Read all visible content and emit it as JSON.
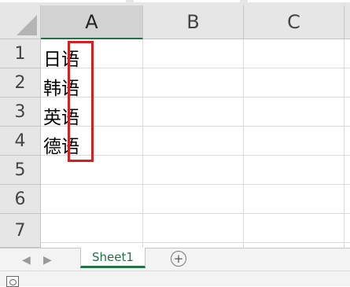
{
  "columns": [
    {
      "label": "A",
      "selected": true
    },
    {
      "label": "B",
      "selected": false
    },
    {
      "label": "C",
      "selected": false
    }
  ],
  "rows": [
    "1",
    "2",
    "3",
    "4",
    "5",
    "6",
    "7"
  ],
  "cells": {
    "A1": "日语",
    "A2": "韩语",
    "A3": "英语",
    "A4": "德语"
  },
  "sheet_tabs": [
    {
      "label": "Sheet1",
      "active": true
    }
  ],
  "tab_nav": {
    "prev_icon": "triangle-left-icon",
    "next_icon": "triangle-right-icon",
    "add_sheet_icon": "plus-circle-icon"
  },
  "colors": {
    "accent_green": "#217346",
    "highlight_red": "#d42020",
    "header_bg": "#e6e6e6",
    "gridline": "#dadada"
  }
}
